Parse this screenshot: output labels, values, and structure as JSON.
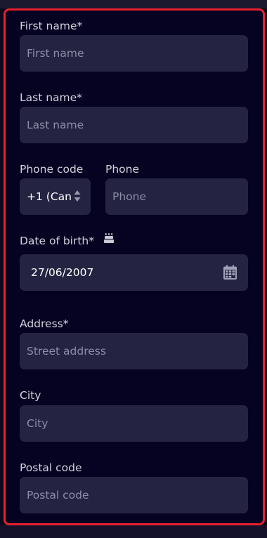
{
  "form": {
    "first_name": {
      "label": "First name*",
      "placeholder": "First name"
    },
    "last_name": {
      "label": "Last name*",
      "placeholder": "Last name"
    },
    "phone_code": {
      "label": "Phone code",
      "value": "+1 (Can"
    },
    "phone": {
      "label": "Phone",
      "placeholder": "Phone"
    },
    "date_of_birth": {
      "label": "Date of birth*",
      "value": "27/06/2007"
    },
    "address": {
      "label": "Address*",
      "placeholder": "Street address"
    },
    "city": {
      "label": "City",
      "placeholder": "City"
    },
    "postal_code": {
      "label": "Postal code",
      "placeholder": "Postal code"
    }
  },
  "icons": {
    "birthday": "birthday-cake-icon",
    "calendar": "calendar-icon",
    "stepper": "up-down-arrows-icon"
  },
  "colors": {
    "highlight_border": "#e8202e",
    "panel_bg": "#050321",
    "field_bg": "#242341"
  }
}
